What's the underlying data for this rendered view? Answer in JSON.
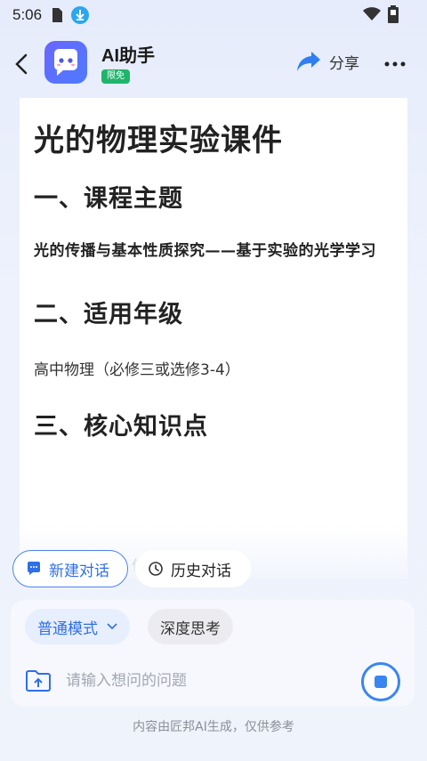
{
  "status_bar": {
    "time": "5:06",
    "icons": [
      "sim-card-icon",
      "download-icon",
      "wifi-icon",
      "battery-icon"
    ]
  },
  "header": {
    "app_name": "AI助手",
    "badge": "限免",
    "share_label": "分享",
    "back_icon": "chevron-left-icon",
    "more_icon": "more-dots-icon"
  },
  "document": {
    "title": "光的物理实验课件",
    "section1_heading": "一、课程主题",
    "section1_text": "光的传播与基本性质探究——基于实验的光学学习",
    "section2_heading": "二、适用年级",
    "section2_text": "高中物理（必修三或选修3-4）",
    "section3_heading": "三、核心知识点",
    "partial_text": "传"
  },
  "quick_actions": {
    "new_chat": "新建对话",
    "history": "历史对话"
  },
  "input_panel": {
    "mode_normal": "普通模式",
    "mode_deep": "深度思考",
    "placeholder": "请输入想问的问题"
  },
  "footer": {
    "note": "内容由匠邦AI生成，仅供参考"
  },
  "colors": {
    "accent": "#2f6fe8",
    "badge_green": "#1fb56c",
    "stop_blue": "#3a86f0"
  }
}
